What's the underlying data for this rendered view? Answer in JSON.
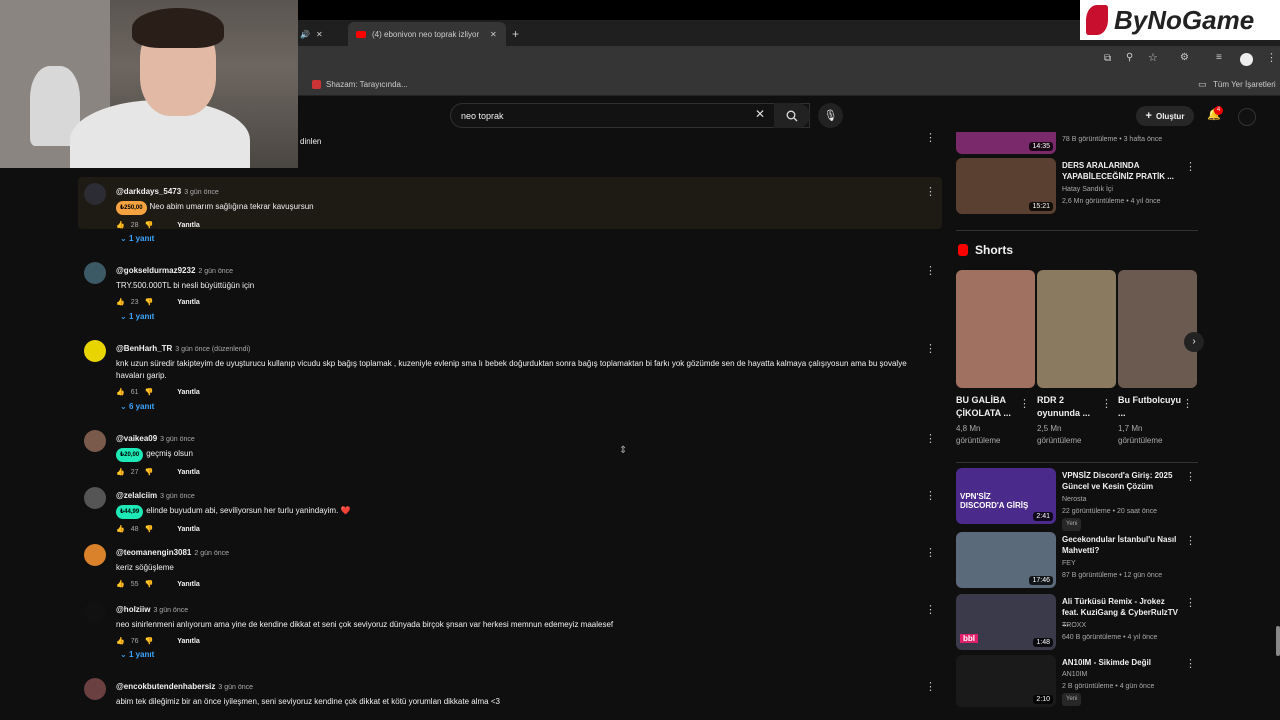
{
  "browser": {
    "tabs": [
      {
        "label": "(4) ebonivon neo toprak izliyor"
      }
    ],
    "bookmarks": [
      {
        "label": "Shazam: Tarayıcında..."
      },
      {
        "label": "Tüm Yer İşaretleri"
      }
    ]
  },
  "logo": {
    "text": "ByNoGame"
  },
  "header": {
    "search_value": "neo toprak",
    "create_label": "Oluştur",
    "notification_count": "4"
  },
  "comments": [
    {
      "author": "",
      "time": "",
      "text": "dinlen",
      "likes": "",
      "replies": ""
    },
    {
      "author": "@darkdays_5473",
      "time": "3 gün önce",
      "thanks": "₺250,00",
      "thanks_color": "#f4a340",
      "text": "Neo abim umarım sağlığına tekrar kavuşursun",
      "likes": "28",
      "reply_label": "Yanıtla",
      "replies": "1 yanıt",
      "avatar_color": "#2c2c34"
    },
    {
      "author": "@gokseldurmaz9232",
      "time": "2 gün önce",
      "text": "TRY.500.000TL bi nesli büyüttüğün için",
      "likes": "23",
      "reply_label": "Yanıtla",
      "replies": "1 yanıt",
      "avatar_color": "#3b5a66"
    },
    {
      "author": "@BenHarh_TR",
      "time": "3 gün önce (düzenlendi)",
      "text": "knk uzun süredir takipteyim de uyuşturucu kullanıp vicudu skp bağış toplamak , kuzeniyle evlenip sma lı bebek doğurduktan sonra bağış toplamaktan bi farkı yok gözümde sen de hayatta kalmaya çalışıyosun ama bu şovalye havaları garip.",
      "likes": "61",
      "reply_label": "Yanıtla",
      "replies": "6 yanıt",
      "avatar_color": "#e8d400"
    },
    {
      "author": "@vaikea09",
      "time": "3 gün önce",
      "thanks": "₺20,00",
      "thanks_color": "#1de9b6",
      "text": "geçmiş olsun",
      "likes": "27",
      "reply_label": "Yanıtla",
      "replies": "",
      "avatar_color": "#7a5a4a"
    },
    {
      "author": "@zelalciim",
      "time": "3 gün önce",
      "thanks": "₺44,99",
      "thanks_color": "#1de9b6",
      "text": "elinde buyudum abi, seviliyorsun her turlu yanindayim. ❤️",
      "likes": "48",
      "reply_label": "Yanıtla",
      "replies": "",
      "avatar_color": "#555"
    },
    {
      "author": "@teomanengin3081",
      "time": "2 gün önce",
      "text": "keriz söğüşleme",
      "likes": "55",
      "reply_label": "Yanıtla",
      "replies": "",
      "avatar_color": "#d9822b"
    },
    {
      "author": "@holziiw",
      "time": "3 gün önce",
      "text": "neo sinirlenmeni anlıyorum ama yine de kendine dikkat et seni çok seviyoruz dünyada birçok şnsan var herkesi memnun edemeyiz maalesef",
      "likes": "76",
      "reply_label": "Yanıtla",
      "replies": "1 yanıt",
      "avatar_color": "#111"
    },
    {
      "author": "@encokbutendenhabersiz",
      "time": "3 gün önce",
      "text": "abim tek dileğimiz bir an önce iyileşmen, seni seviyoruz kendine çok dikkat et kötü yorumlan dikkate alma <3",
      "likes": "",
      "reply_label": "",
      "replies": "",
      "avatar_color": "#6a4040"
    }
  ],
  "sidebar": {
    "top_videos": [
      {
        "title": "",
        "channel": "",
        "stats": "78 B görüntüleme • 3 hafta önce",
        "duration": "14:35",
        "thumb_color": "#7a2a6a"
      },
      {
        "title": "DERS ARALARINDA YAPABİLECEĞİNİZ PRATİK ...",
        "channel": "Hatay Sandık İçi",
        "stats": "2,6 Mn görüntüleme • 4 yıl önce",
        "duration": "15:21",
        "thumb_color": "#5a4030"
      }
    ],
    "shorts_label": "Shorts",
    "shorts": [
      {
        "title": "BU GALİBA ÇİKOLATA ...",
        "views": "4,8 Mn görüntüleme",
        "color": "#a07060"
      },
      {
        "title": "RDR 2 oyununda ...",
        "views": "2,5 Mn görüntüleme",
        "color": "#8a7a60"
      },
      {
        "title": "Bu Futbolcuyu ...",
        "views": "1,7 Mn görüntüleme",
        "color": "#6a5a50"
      }
    ],
    "videos": [
      {
        "title": "VPNSİZ Discord'a Giriş: 2025 Güncel ve Kesin Çözüm",
        "channel": "Nerosta",
        "stats": "22 görüntüleme • 20 saat önce",
        "badge": "Yeni",
        "duration": "2:41",
        "thumb_color": "#4a2a8a",
        "thumb_text": "VPN'SİZ DISCORD'A GİRİŞ"
      },
      {
        "title": "Gecekondular İstanbul'u Nasıl Mahvetti?",
        "channel": "FEY",
        "stats": "87 B görüntüleme • 12 gün önce",
        "badge": "",
        "duration": "17:46",
        "thumb_color": "#5a6a7a",
        "thumb_text": ""
      },
      {
        "title": "Ali Türküsü Remix - Jrokez feat. KuziGang & CyberRulzTV ...",
        "channel": "TROXX",
        "stats": "640 B görüntüleme • 4 yıl önce",
        "badge": "",
        "duration": "1:48",
        "thumb_color": "#3a3a4a",
        "thumb_text": "bbl"
      },
      {
        "title": "AN10IM - Sikimde Değil",
        "channel": "AN10IM",
        "stats": "2 B görüntüleme • 4 gün önce",
        "badge": "Yeni",
        "duration": "2:10",
        "thumb_color": "#1a1a1a",
        "thumb_text": ""
      }
    ]
  },
  "colors": {
    "accent": "#3ea6ff",
    "bg": "#0f0f0f",
    "highlight": "#1e1a14"
  }
}
